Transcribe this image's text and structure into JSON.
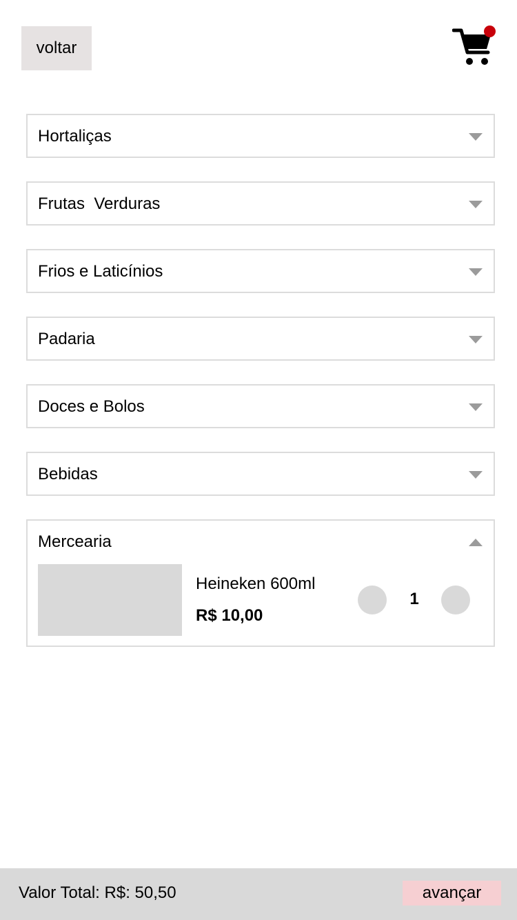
{
  "header": {
    "back_label": "voltar",
    "cart_icon": "shopping-cart-icon",
    "cart_badge_color": "#c8000a"
  },
  "categories": [
    {
      "label": "Hortaliças",
      "state": "collapsed"
    },
    {
      "label": "Frutas  Verduras",
      "state": "collapsed"
    },
    {
      "label": "Frios e Laticínios",
      "state": "collapsed"
    },
    {
      "label": "Padaria",
      "state": "collapsed"
    },
    {
      "label": "Doces e Bolos",
      "state": "collapsed"
    },
    {
      "label": "Bebidas",
      "state": "collapsed"
    },
    {
      "label": "Mercearia",
      "state": "expanded"
    }
  ],
  "product": {
    "name": "Heineken 600ml",
    "price": "R$ 10,00",
    "quantity": "1"
  },
  "footer": {
    "total_label": "Valor Total: R$: 50,50",
    "next_label": "avançar",
    "next_color": "#f6cfd2"
  }
}
